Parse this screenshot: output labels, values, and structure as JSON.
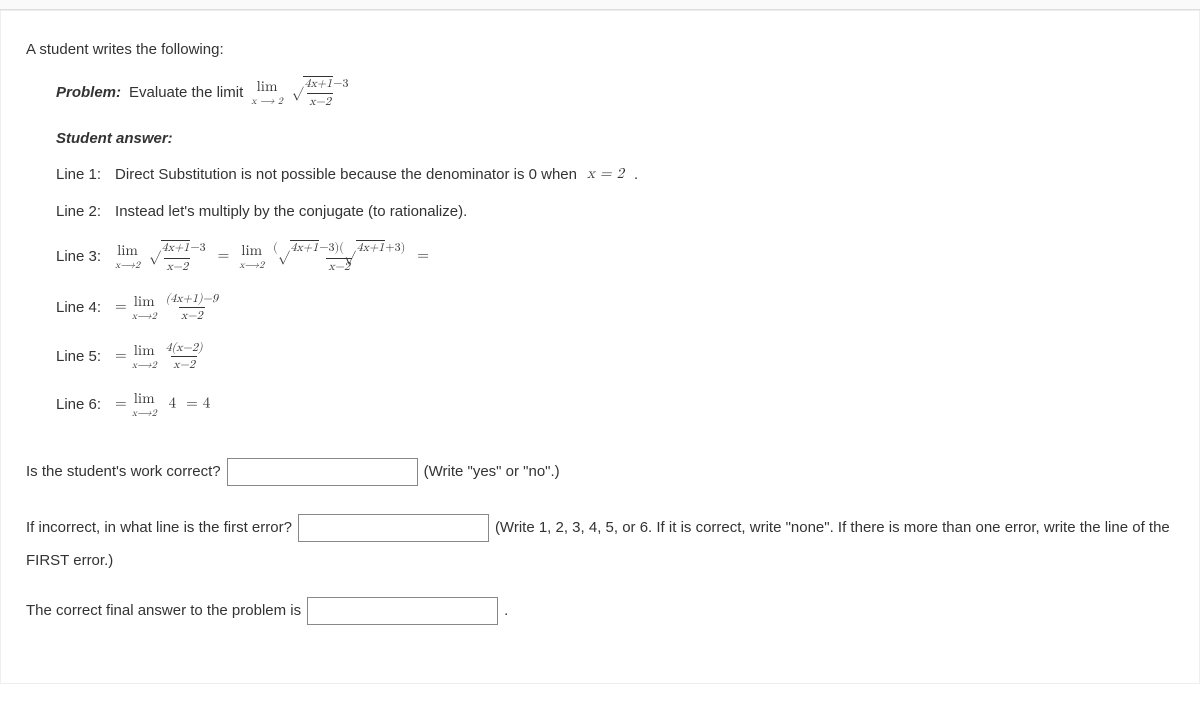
{
  "intro": "A student writes the following:",
  "problem": {
    "label": "Problem:",
    "text": "Evaluate the limit",
    "lim_top": "lim",
    "lim_bot": "x ⟶ 2",
    "frac_num_sqrt_arg": "4x+1",
    "frac_num_tail": "−3",
    "frac_den": "x−2"
  },
  "student_answer_label": "Student answer:",
  "lines": {
    "l1_label": "Line 1:",
    "l1_text": "Direct Substitution is not possible because the denominator is 0 when",
    "l1_eq": "x = 2",
    "l1_tail": ".",
    "l2_label": "Line 2:",
    "l2_text": "Instead let's multiply by the conjugate (to rationalize).",
    "l3_label": "Line 3:",
    "l3_lim_top": "lim",
    "l3_lim_bot": "x⟶2",
    "l3_lhs_num_sqrt": "4x+1",
    "l3_lhs_num_tail": "−3",
    "l3_lhs_den": "x−2",
    "l3_rhs_num_sqrt1": "4x+1",
    "l3_rhs_num_mid1": "−3",
    "l3_rhs_num_sqrt2": "4x+1",
    "l3_rhs_num_mid2": "+3",
    "l3_rhs_den": "x−2",
    "l4_label": "Line 4:",
    "l4_frac_num": "(4x+1)−9",
    "l4_frac_den": "x−2",
    "l5_label": "Line 5:",
    "l5_frac_num": "4(x−2)",
    "l5_frac_den": "x−2",
    "l6_label": "Line 6:",
    "l6_expr": "4",
    "l6_result": "= 4",
    "eq": "=",
    "eq_prefix": "= "
  },
  "questions": {
    "q1_text": "Is the student's work correct?",
    "q1_hint": "(Write \"yes\" or \"no\".)",
    "q2_text": "If incorrect, in what line is the first error?",
    "q2_hint": "(Write 1, 2, 3, 4, 5, or 6. If it is correct, write \"none\". If there is more than one error, write the line of the",
    "q2_tail": "FIRST error.)",
    "q3_text": "The correct final answer to the problem is",
    "q3_tail": "."
  }
}
